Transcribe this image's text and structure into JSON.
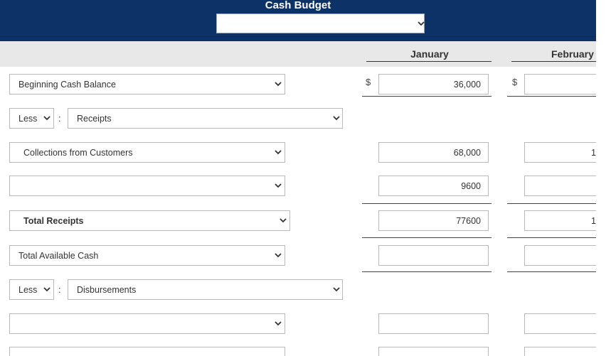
{
  "header": {
    "title": "Cash Budget",
    "period_select_value": ""
  },
  "columns": {
    "january": "January",
    "february": "February"
  },
  "currency_symbol": "$",
  "rows": {
    "beginning_cash": {
      "label": "Beginning Cash Balance",
      "january": "36,000",
      "february": ""
    },
    "less_receipts": {
      "operator": "Less",
      "colon": ":",
      "label": "Receipts"
    },
    "collections": {
      "label": "Collections from Customers",
      "january": "68,000",
      "february": "1"
    },
    "receipt_blank": {
      "label": "",
      "january": "9600",
      "february": ""
    },
    "total_receipts": {
      "label": "Total Receipts",
      "january": "77600",
      "february": "1"
    },
    "total_available": {
      "label": "Total Available Cash",
      "january": "",
      "february": ""
    },
    "less_disbursements": {
      "operator": "Less",
      "colon": ":",
      "label": "Disbursements"
    },
    "disb_blank_1": {
      "label": "",
      "january": "",
      "february": ""
    },
    "disb_blank_2": {
      "label": "",
      "january": "",
      "february": ""
    }
  }
}
